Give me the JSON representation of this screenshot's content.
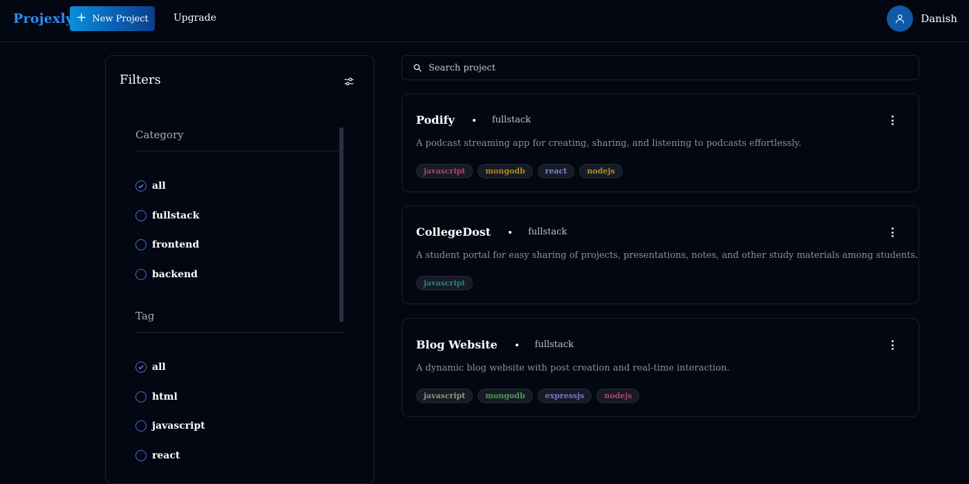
{
  "app": {
    "brand": "Projexly",
    "new_project_label": "New Project",
    "upgrade_label": "Upgrade",
    "user_name": "Danish",
    "accent": "#2f8bf0"
  },
  "filters": {
    "title": "Filters",
    "category": {
      "label": "Category",
      "options": [
        "all",
        "fullstack",
        "frontend",
        "backend"
      ],
      "selected": "all"
    },
    "tag": {
      "label": "Tag",
      "options": [
        "all",
        "html",
        "javascript",
        "react"
      ],
      "selected": "all"
    }
  },
  "search": {
    "placeholder": "Search project"
  },
  "projects": [
    {
      "name": "Podify",
      "category": "fullstack",
      "description": "A podcast streaming app for creating, sharing, and listening to podcasts effortlessly.",
      "tags": [
        {
          "label": "javascript",
          "color": "#b0406e"
        },
        {
          "label": "mongodb",
          "color": "#b08a1a"
        },
        {
          "label": "react",
          "color": "#7d87c9"
        },
        {
          "label": "nodejs",
          "color": "#b0921a"
        }
      ]
    },
    {
      "name": "CollegeDost",
      "category": "fullstack",
      "description": "A student portal for easy sharing of projects, presentations, notes, and other study materials among students.",
      "tags": [
        {
          "label": "javascript",
          "color": "#2f7d7a"
        }
      ]
    },
    {
      "name": "Blog Website",
      "category": "fullstack",
      "description": "A dynamic blog website with post creation and real-time interaction.",
      "tags": [
        {
          "label": "javascript",
          "color": "#8a9a7c"
        },
        {
          "label": "mongodb",
          "color": "#4c9a56"
        },
        {
          "label": "expressjs",
          "color": "#8a6fd0"
        },
        {
          "label": "nodejs",
          "color": "#b0406e"
        }
      ]
    }
  ]
}
